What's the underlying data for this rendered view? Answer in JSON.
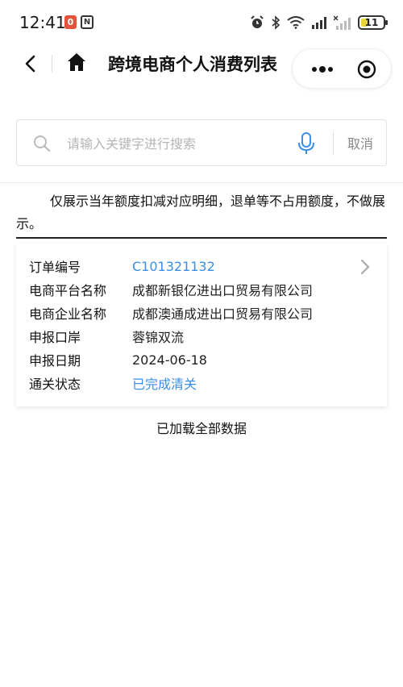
{
  "status_bar": {
    "time": "12:41",
    "badge": "0",
    "nfc": "N",
    "battery": "11",
    "icons": [
      "alarm-icon",
      "bluetooth-icon",
      "wifi-icon",
      "signal-icon",
      "signal-no-icon",
      "battery-icon"
    ]
  },
  "nav": {
    "title": "跨境电商个人消费列表"
  },
  "search": {
    "placeholder": "请输入关键字进行搜索",
    "value": "",
    "cancel_label": "取消"
  },
  "notice": "仅展示当年额度扣减对应明细，退单等不占用额度，不做展示。",
  "order": {
    "fields": [
      {
        "label": "订单编号",
        "value": "C101321132"
      },
      {
        "label": "电商平台名称",
        "value": "成都新银亿进出口贸易有限公司"
      },
      {
        "label": "电商企业名称",
        "value": "成都澳通成进出口贸易有限公司"
      },
      {
        "label": "申报口岸",
        "value": "蓉锦双流"
      },
      {
        "label": "申报日期",
        "value": "2024-06-18"
      },
      {
        "label": "通关状态",
        "value": "已完成清关"
      }
    ]
  },
  "footer": {
    "load_all": "已加载全部数据"
  },
  "colors": {
    "link": "#3a8ee6",
    "badge_red": "#e5533d",
    "battery_yellow": "#e8d63a"
  }
}
